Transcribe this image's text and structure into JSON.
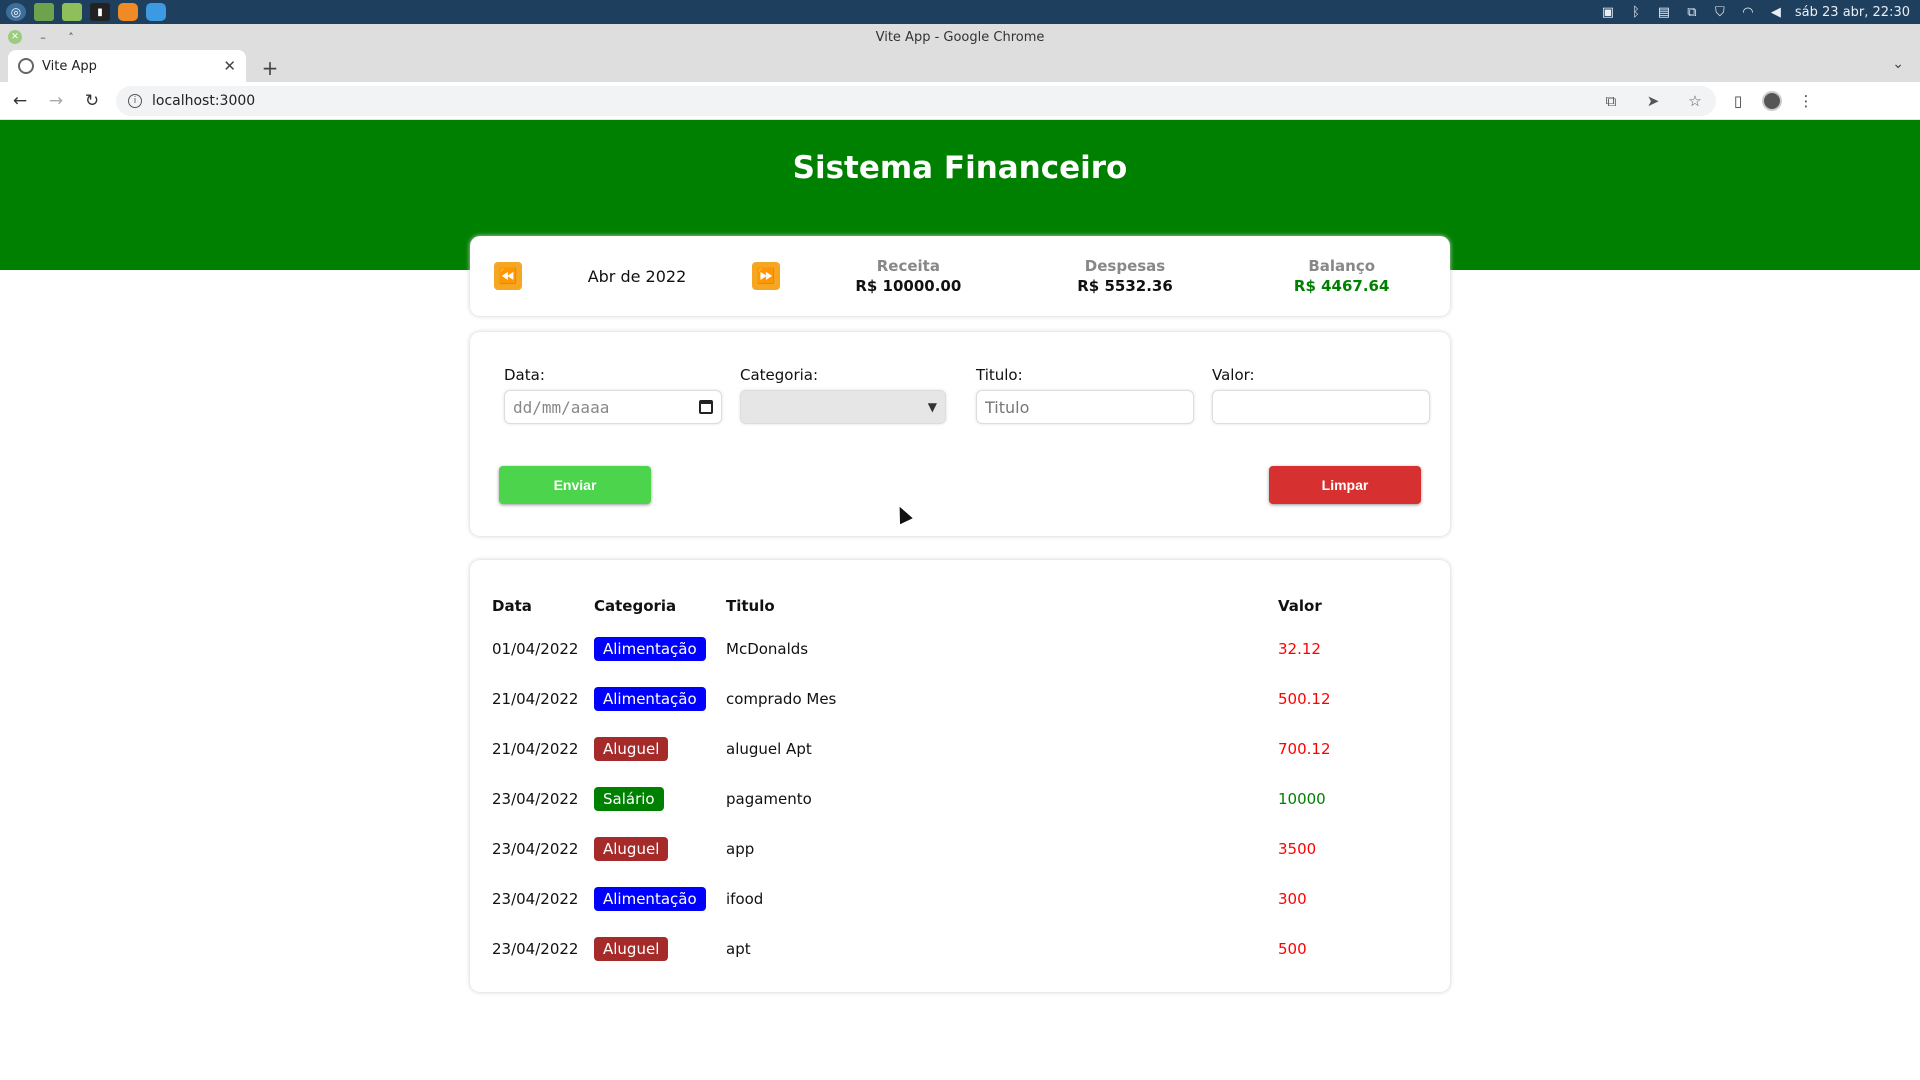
{
  "os": {
    "clock": "sáb 23 abr, 22:30"
  },
  "browser": {
    "window_title": "Vite App - Google Chrome",
    "tab_title": "Vite App",
    "url": "localhost:3000"
  },
  "app": {
    "header_title": "Sistema Financeiro",
    "month": "Abr de 2022",
    "summary": {
      "receita_label": "Receita",
      "receita_value": "R$ 10000.00",
      "despesas_label": "Despesas",
      "despesas_value": "R$ 5532.36",
      "balanco_label": "Balanço",
      "balanco_value": "R$ 4467.64"
    },
    "form": {
      "date_label": "Data:",
      "date_placeholder": "dd/mm/aaaa",
      "category_label": "Categoria:",
      "category_value": "",
      "title_label": "Titulo:",
      "title_placeholder": "Titulo",
      "value_label": "Valor:",
      "value_placeholder": "",
      "submit_label": "Enviar",
      "clear_label": "Limpar"
    },
    "table": {
      "headers": {
        "date": "Data",
        "category": "Categoria",
        "title": "Titulo",
        "value": "Valor"
      },
      "rows": [
        {
          "date": "01/04/2022",
          "category": "Alimentação",
          "title": "McDonalds",
          "value": "32.12"
        },
        {
          "date": "21/04/2022",
          "category": "Alimentação",
          "title": "comprado Mes",
          "value": "500.12"
        },
        {
          "date": "21/04/2022",
          "category": "Aluguel",
          "title": "aluguel Apt",
          "value": "700.12"
        },
        {
          "date": "23/04/2022",
          "category": "Salário",
          "title": "pagamento",
          "value": "10000"
        },
        {
          "date": "23/04/2022",
          "category": "Aluguel",
          "title": "app",
          "value": "3500"
        },
        {
          "date": "23/04/2022",
          "category": "Alimentação",
          "title": "ifood",
          "value": "300"
        },
        {
          "date": "23/04/2022",
          "category": "Aluguel",
          "title": "apt",
          "value": "500"
        }
      ]
    },
    "colors": {
      "header": "#008000",
      "alimentacao": "#0000ff",
      "aluguel": "#a52a2a",
      "salario": "#008000",
      "expense": "#ff0000",
      "income": "#008000",
      "enviar": "#4cd44c",
      "limpar": "#d63030"
    }
  }
}
